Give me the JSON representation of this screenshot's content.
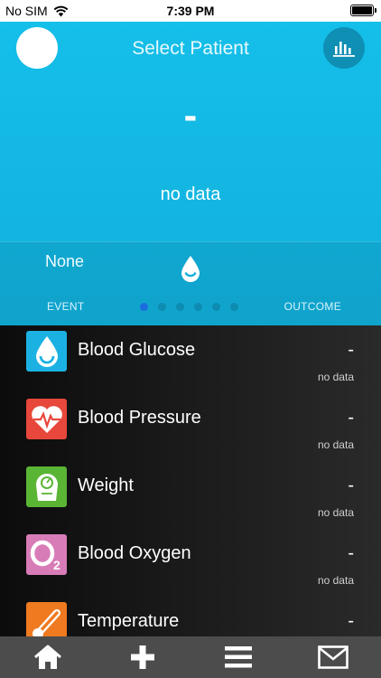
{
  "status": {
    "carrier": "No SIM",
    "time": "7:39 PM"
  },
  "header": {
    "title": "Select Patient",
    "value": "-",
    "value_sub": "no data",
    "event_value": "None",
    "event_label": "EVENT",
    "outcome_label": "OUTCOME",
    "pager": {
      "count": 6,
      "active_index": 0
    }
  },
  "metrics": [
    {
      "name": "Blood Glucose",
      "value": "-",
      "sub": "no data",
      "icon": "blood-drop-icon",
      "color": "#1bb2e3"
    },
    {
      "name": "Blood Pressure",
      "value": "-",
      "sub": "no data",
      "icon": "heart-pulse-icon",
      "color": "#e8473b"
    },
    {
      "name": "Weight",
      "value": "-",
      "sub": "no data",
      "icon": "scale-icon",
      "color": "#5bb535"
    },
    {
      "name": "Blood Oxygen",
      "value": "-",
      "sub": "no data",
      "icon": "o2-icon",
      "color": "#d87cb8"
    },
    {
      "name": "Temperature",
      "value": "-",
      "sub": "",
      "icon": "thermometer-icon",
      "color": "#f07a1f"
    }
  ],
  "tabbar": {
    "items": [
      "home-icon",
      "add-icon",
      "menu-icon",
      "mail-icon"
    ]
  }
}
